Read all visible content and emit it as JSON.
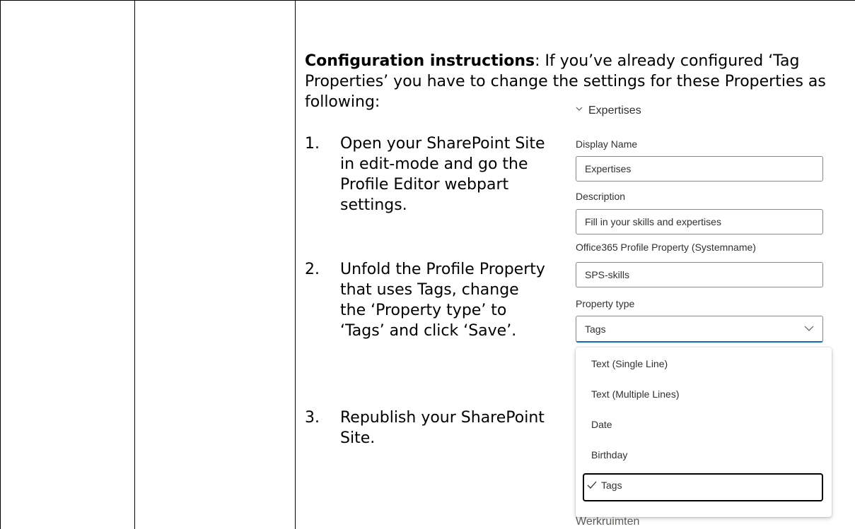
{
  "instructions": {
    "heading": "Configuration instructions",
    "intro_rest": ": If you’ve already configured ‘Tag Properties’ you have to change the settings for these Properties as following:",
    "steps": [
      {
        "num": "1.",
        "text": "Open your SharePoint Site in edit-mode and go the Profile Editor webpart settings."
      },
      {
        "num": "2.",
        "text": "Unfold the Profile Property that uses Tags, change the ‘Property type’ to ‘Tags’ and click ‘Save’."
      },
      {
        "num": "3.",
        "text": "Republish your SharePoint Site."
      }
    ]
  },
  "panel": {
    "section_title": "Expertises",
    "section_icon": "chevron-down-icon",
    "display_name_label": "Display Name",
    "display_name_value": "Expertises",
    "description_label": "Description",
    "description_value": "Fill in your skills and expertises",
    "system_name_label": "Office365 Profile Property (Systemname)",
    "system_name_value": "SPS-skills",
    "property_type_label": "Property type",
    "property_type_value": "Tags",
    "options": [
      "Text (Single Line)",
      "Text (Multiple Lines)",
      "Date",
      "Birthday",
      "Tags"
    ],
    "selected_option": "Tags",
    "next_section_peek": "Werkruimten"
  }
}
